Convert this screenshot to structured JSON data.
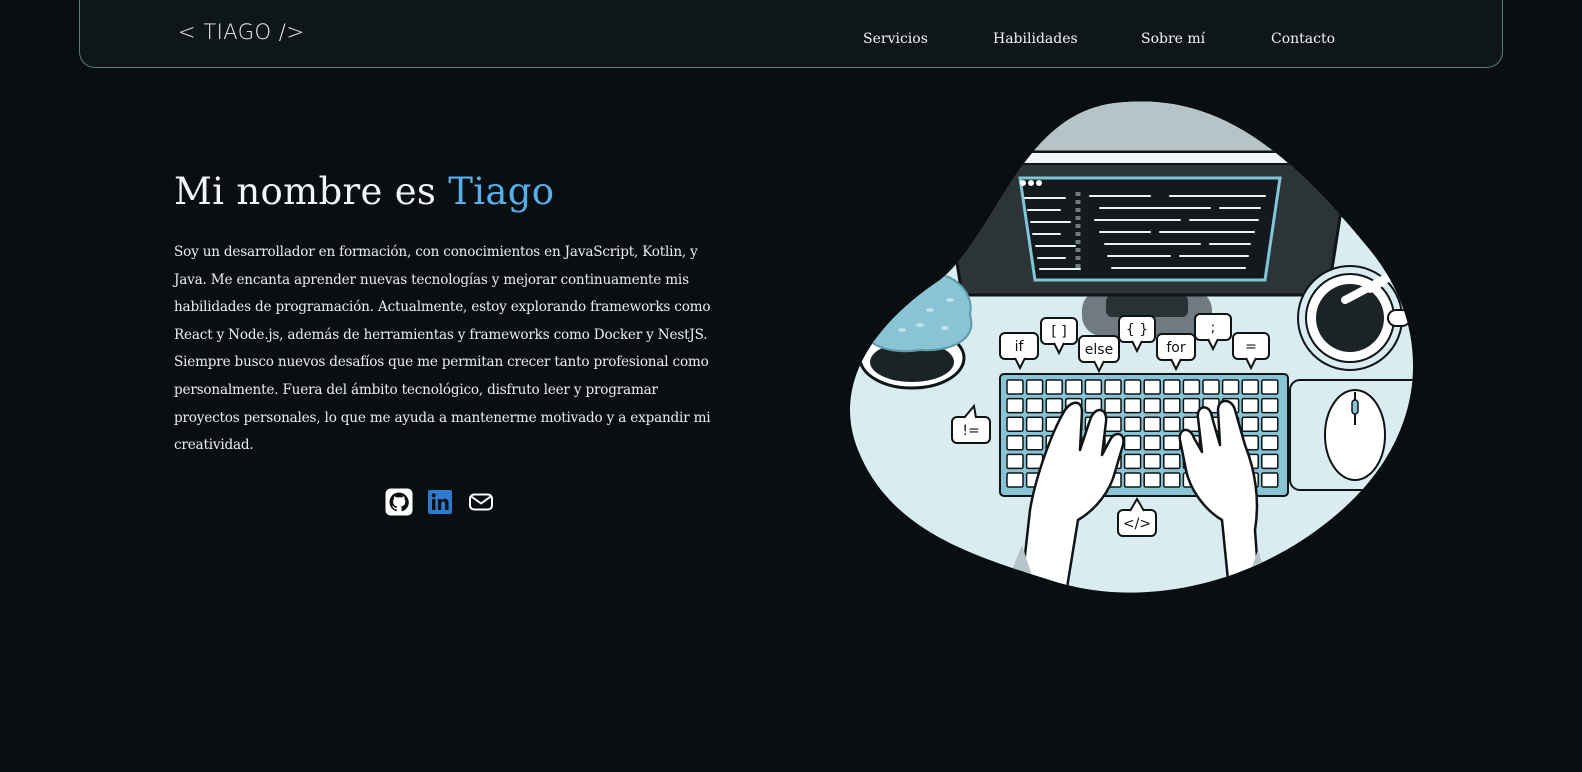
{
  "header": {
    "logo": "< TIAGO />",
    "nav": [
      {
        "label": "Servicios"
      },
      {
        "label": "Habilidades"
      },
      {
        "label": "Sobre mí"
      },
      {
        "label": "Contacto"
      }
    ]
  },
  "hero": {
    "title_prefix": "Mi nombre es ",
    "title_name": "Tiago",
    "description": "Soy un desarrollador en formación, con conocimientos en JavaScript, Kotlin, y Java. Me encanta aprender nuevas tecnologías y mejorar continuamente mis habilidades de programación. Actualmente, estoy explorando frameworks como React y Node.js, además de herramientas y frameworks como Docker y NestJS. Siempre busco nuevos desafíos que me permitan crecer tanto profesional como personalmente. Fuera del ámbito tecnológico, disfruto leer y programar proyectos personales, lo que me ayuda a mantenerme motivado y a expandir mi creatividad."
  },
  "socials": [
    {
      "icon": "github-icon"
    },
    {
      "icon": "linkedin-icon"
    },
    {
      "icon": "mail-icon"
    }
  ],
  "illustration": {
    "code_bubbles": [
      "if",
      "[ ]",
      "else",
      "{ }",
      "for",
      ";",
      "=",
      "!=",
      "</>"
    ]
  },
  "colors": {
    "background": "#090e10",
    "accent": "#57aee9",
    "nav_background": "#0e1619",
    "nav_border": "#5a7a80",
    "blob": "#d9ecf0",
    "linkedin": "#2f7ad0"
  }
}
